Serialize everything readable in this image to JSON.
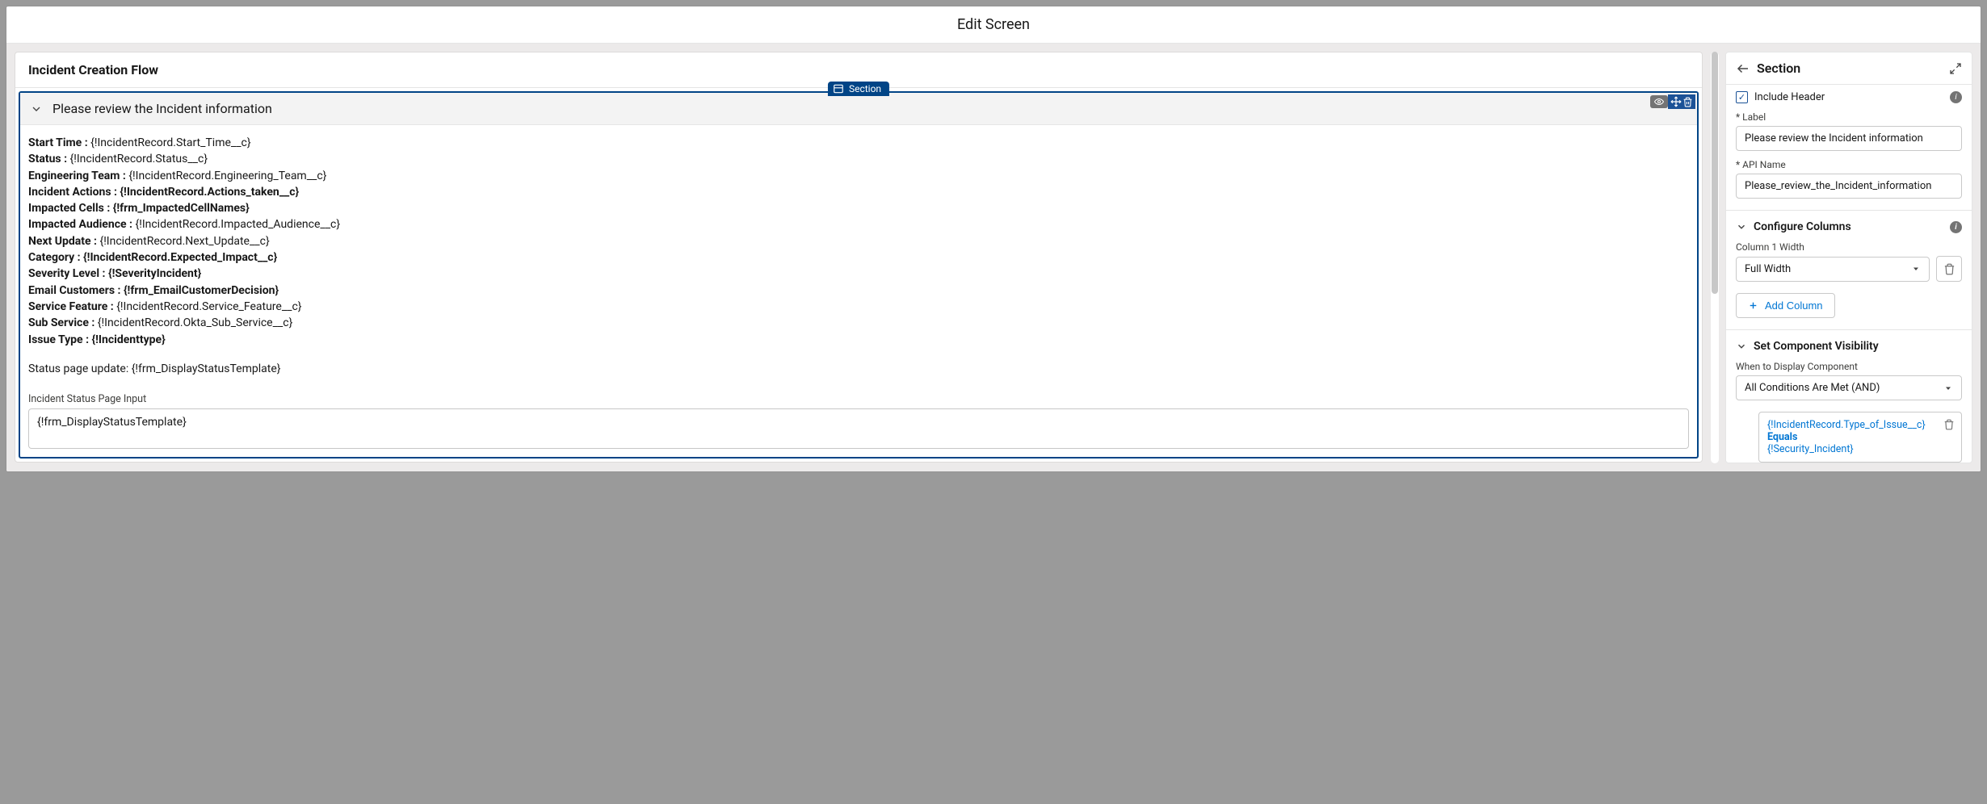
{
  "title": "Edit Screen",
  "canvas": {
    "flow_title": "Incident Creation Flow",
    "section_tab": "Section",
    "section_title": "Please review the Incident information",
    "fields": [
      {
        "label": "Start Time :",
        "value": " {!IncidentRecord.Start_Time__c}",
        "boldLabelOnly": true
      },
      {
        "label": "Status :",
        "value": " {!IncidentRecord.Status__c}",
        "boldLabelOnly": true
      },
      {
        "label": "Engineering Team :",
        "value": " {!IncidentRecord.Engineering_Team__c}",
        "boldLabelOnly": true
      },
      {
        "label": "Incident Actions : {!IncidentRecord.Actions_taken__c}",
        "value": "",
        "boldWhole": true
      },
      {
        "label": "Impacted Cells : {!frm_ImpactedCellNames}",
        "value": "",
        "boldWhole": true
      },
      {
        "label": "Impacted Audience :",
        "value": " {!IncidentRecord.Impacted_Audience__c}",
        "boldLabelOnly": true
      },
      {
        "label": "Next Update :",
        "value": " {!IncidentRecord.Next_Update__c}",
        "boldLabelOnly": true
      },
      {
        "label": "Category : {!IncidentRecord.Expected_Impact__c}",
        "value": "",
        "boldWhole": true
      },
      {
        "label": "Severity Level : {!SeverityIncident}",
        "value": "",
        "boldWhole": true
      },
      {
        "label": "Email Customers : {!frm_EmailCustomerDecision}",
        "value": "",
        "boldWhole": true
      },
      {
        "label": "Service Feature :",
        "value": " {!IncidentRecord.Service_Feature__c}",
        "boldLabelOnly": true
      },
      {
        "label": "Sub Service :",
        "value": " {!IncidentRecord.Okta_Sub_Service__c}",
        "boldLabelOnly": true
      },
      {
        "label": "Issue Type : {!Incidenttype}",
        "value": "",
        "boldWhole": true
      }
    ],
    "status_line": "Status page update: {!frm_DisplayStatusTemplate}",
    "input_label": "Incident Status Page Input",
    "input_value": "{!frm_DisplayStatusTemplate}"
  },
  "side": {
    "title": "Section",
    "include_header": "Include Header",
    "label_lbl": "Label",
    "label_val": "Please review the Incident information",
    "api_lbl": "API Name",
    "api_val": "Please_review_the_Incident_information",
    "config_columns": "Configure Columns",
    "col1_width_lbl": "Column 1 Width",
    "col1_width_val": "Full Width",
    "add_column": "Add Column",
    "visibility_title": "Set Component Visibility",
    "when_display": "When to Display Component",
    "condition_logic": "All Conditions Are Met (AND)",
    "condition": {
      "field": "{!IncidentRecord.Type_of_Issue__c}",
      "operator": "Equals",
      "value": "{!Security_Incident}"
    }
  }
}
